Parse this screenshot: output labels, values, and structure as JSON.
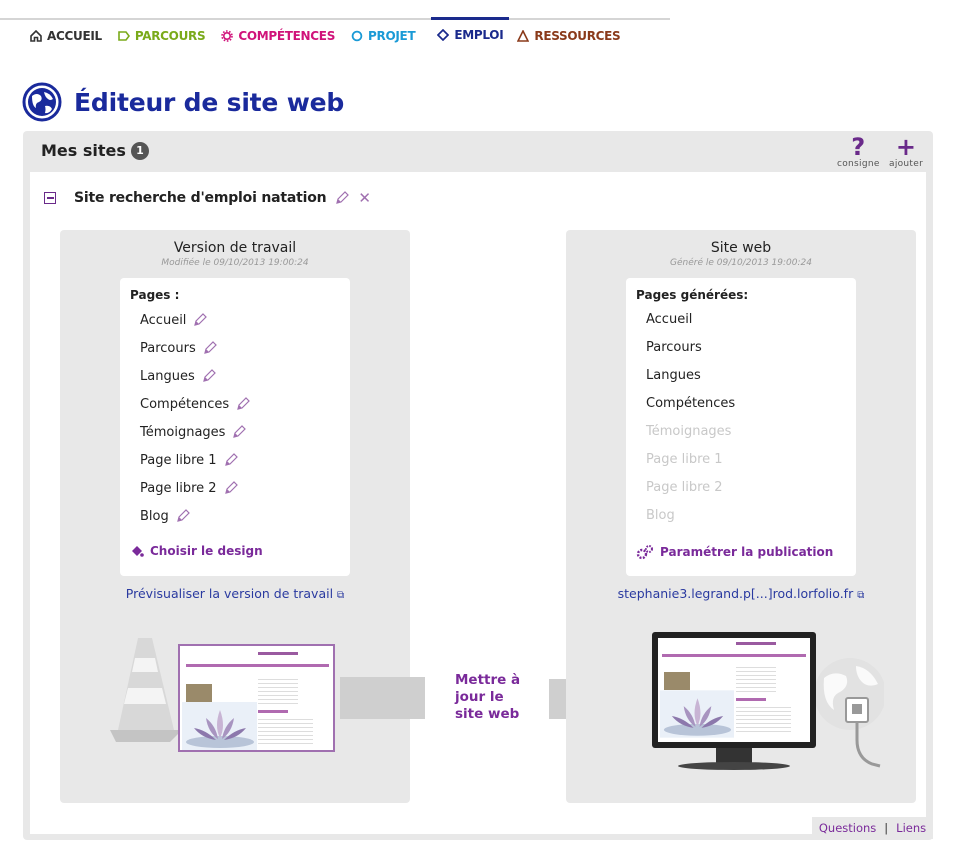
{
  "nav": [
    {
      "label": "ACCUEIL",
      "icon": "home-icon",
      "color": "#333333"
    },
    {
      "label": "PARCOURS",
      "icon": "tag-icon",
      "color": "#7aaa1a"
    },
    {
      "label": "COMPÉTENCES",
      "icon": "gear-icon",
      "color": "#d0127a"
    },
    {
      "label": "PROJET",
      "icon": "circle-icon",
      "color": "#1a9ad6"
    },
    {
      "label": "EMPLOI",
      "icon": "diamond-icon",
      "color": "#1a2a8c"
    },
    {
      "label": "RESSOURCES",
      "icon": "triangle-icon",
      "color": "#8a3a1a"
    }
  ],
  "active_nav": "EMPLOI",
  "title": "Éditeur de site web",
  "panel": {
    "heading": "Mes sites",
    "count": "1",
    "tools": {
      "consigne": "consigne",
      "ajouter": "ajouter"
    }
  },
  "site": {
    "name": "Site recherche d'emploi natation"
  },
  "working": {
    "title": "Version de travail",
    "subtitle": "Modifiée le 09/10/2013 19:00:24",
    "pages_heading": "Pages :",
    "pages": [
      "Accueil",
      "Parcours",
      "Langues",
      "Compétences",
      "Témoignages",
      "Page libre 1",
      "Page libre 2",
      "Blog"
    ],
    "action": "Choisir le design",
    "link": "Prévisualiser la version de travail"
  },
  "website": {
    "title": "Site web",
    "subtitle": "Généré le 09/10/2013 19:00:24",
    "pages_heading": "Pages générées:",
    "pages": [
      {
        "label": "Accueil",
        "generated": true
      },
      {
        "label": "Parcours",
        "generated": true
      },
      {
        "label": "Langues",
        "generated": true
      },
      {
        "label": "Compétences",
        "generated": true
      },
      {
        "label": "Témoignages",
        "generated": false
      },
      {
        "label": "Page libre 1",
        "generated": false
      },
      {
        "label": "Page libre 2",
        "generated": false
      },
      {
        "label": "Blog",
        "generated": false
      }
    ],
    "action": "Paramétrer la publication",
    "link": "stephanie3.legrand.p[...]rod.lorfolio.fr"
  },
  "update_label_lines": [
    "Mettre à",
    "jour le",
    "site web"
  ],
  "footer": {
    "questions": "Questions",
    "liens": "Liens"
  },
  "colors": {
    "accent": "#7a2a9a",
    "title_blue": "#1a2a9c",
    "panel_bg": "#e8e8e8"
  }
}
